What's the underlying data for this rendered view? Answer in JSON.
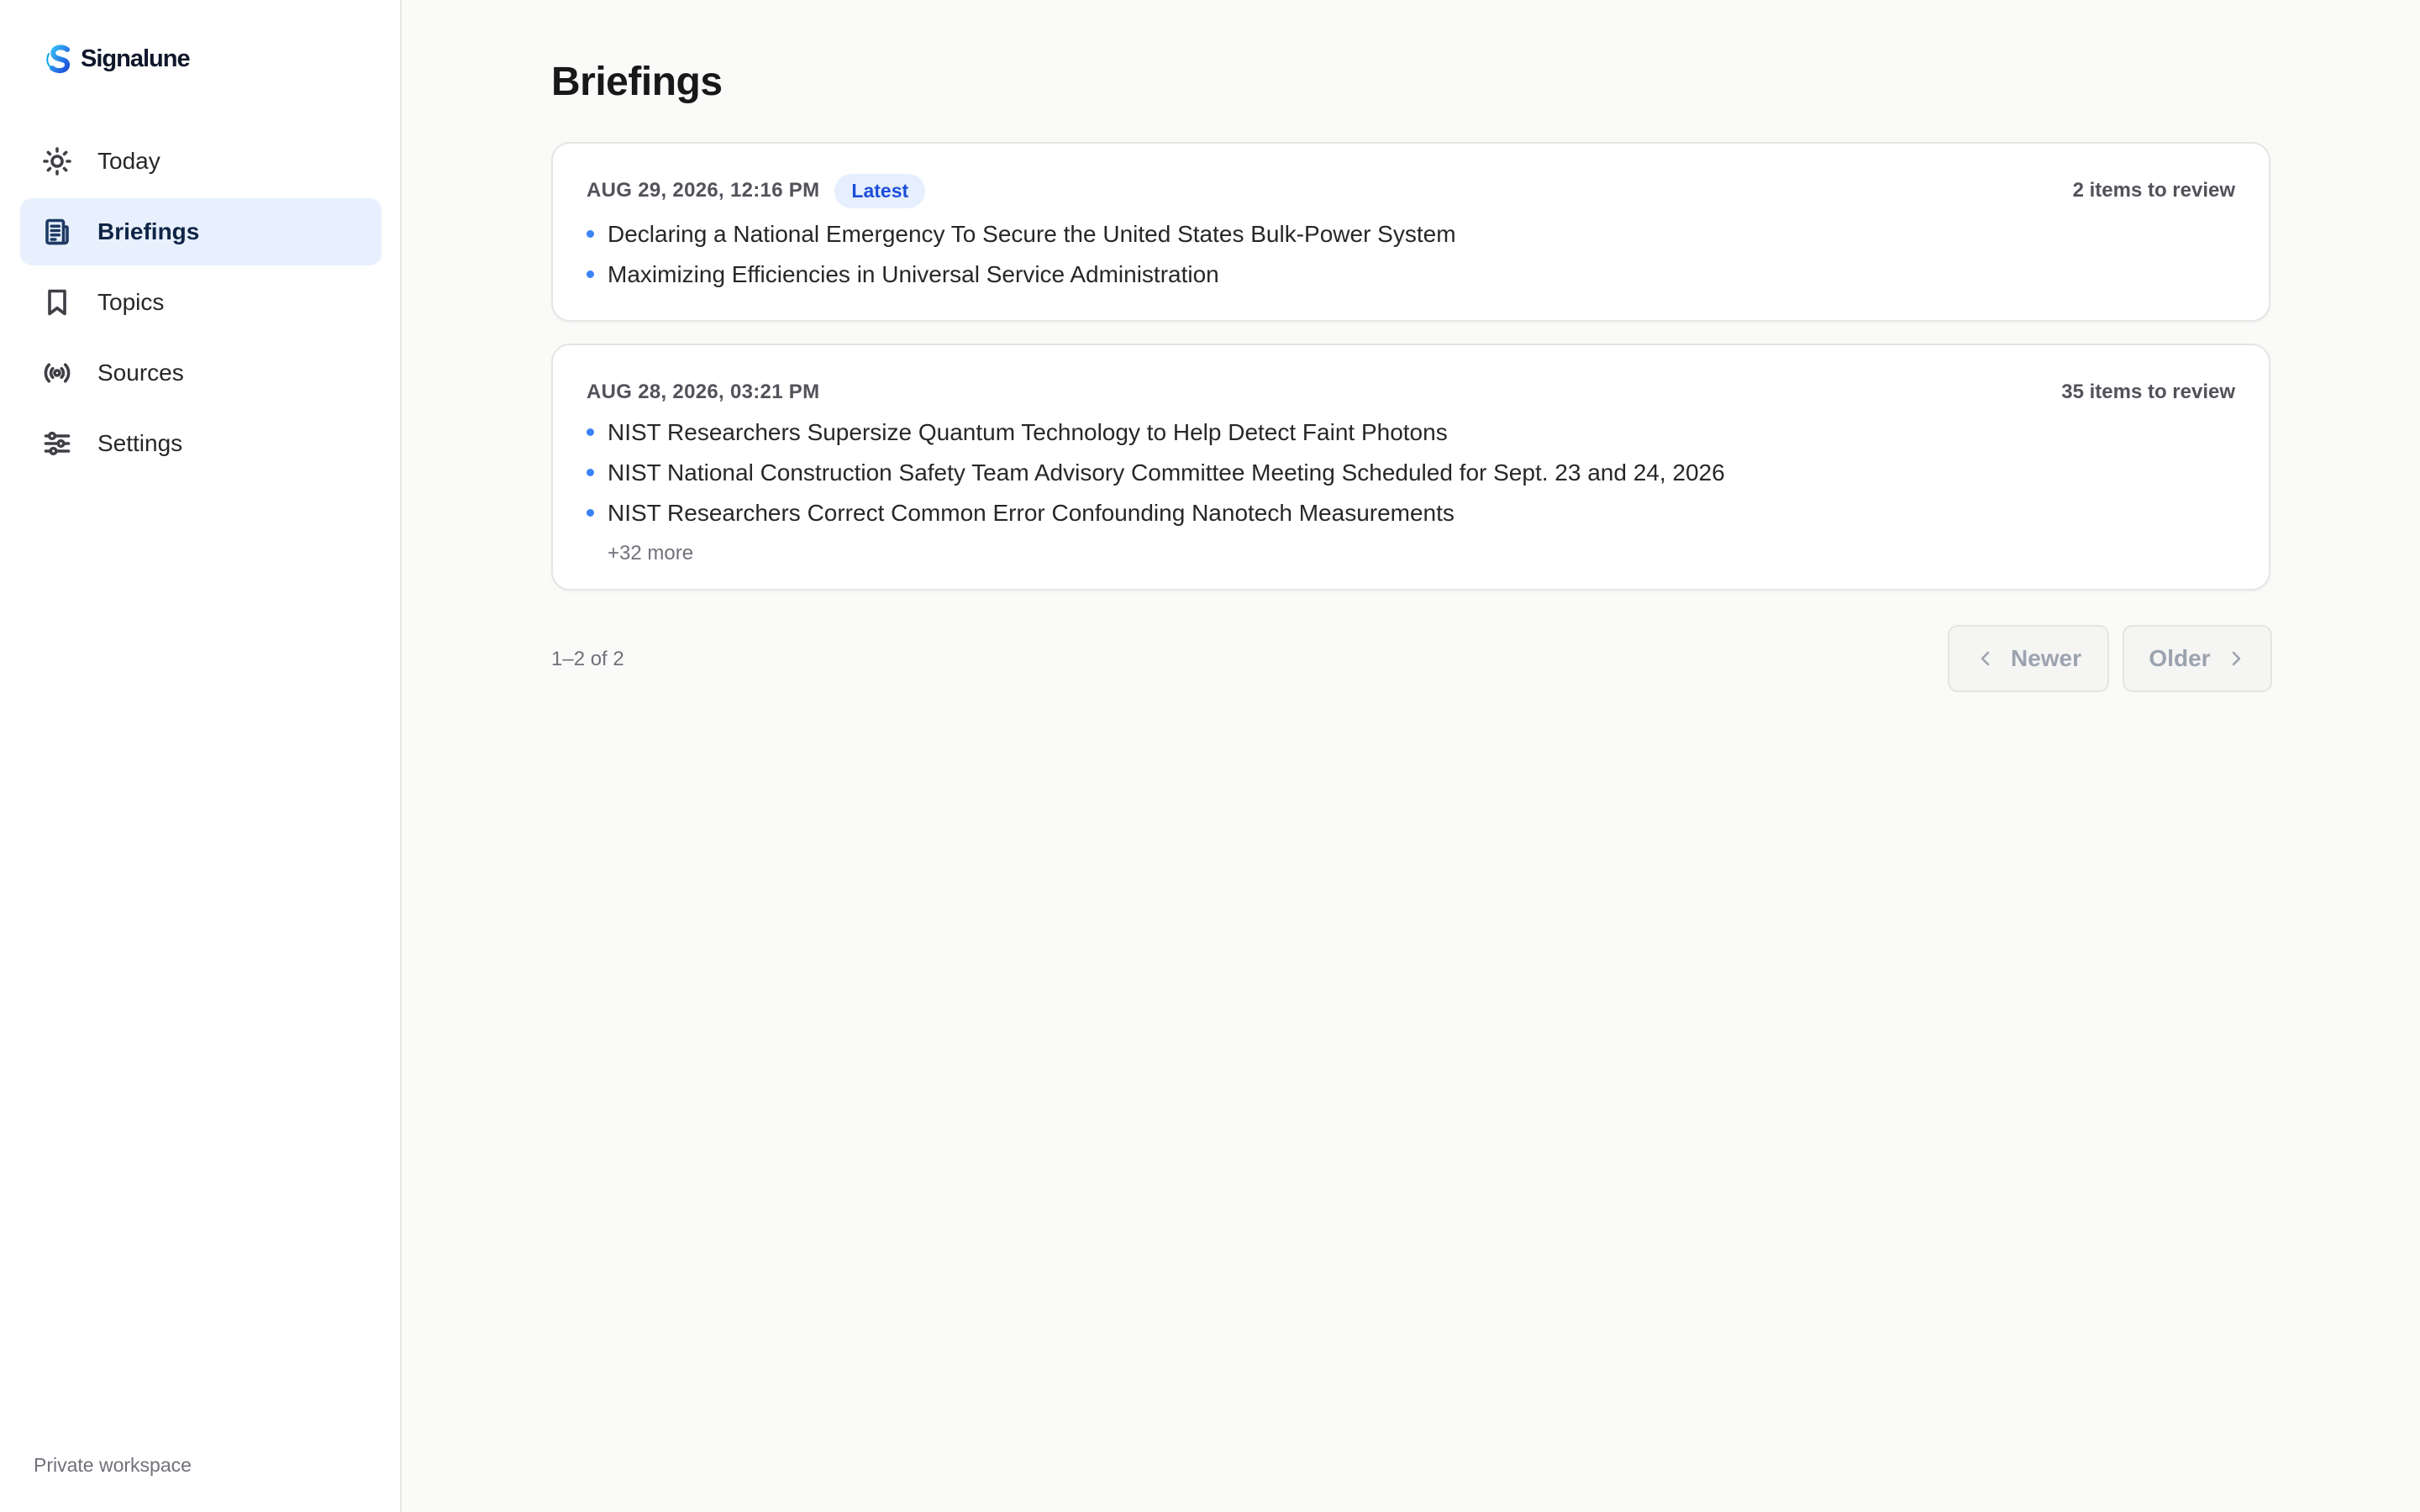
{
  "app": {
    "name": "Signalune"
  },
  "sidebar": {
    "items": [
      {
        "label": "Today",
        "icon": "sun-icon",
        "active": false
      },
      {
        "label": "Briefings",
        "icon": "newspaper-icon",
        "active": true
      },
      {
        "label": "Topics",
        "icon": "bookmark-icon",
        "active": false
      },
      {
        "label": "Sources",
        "icon": "broadcast-icon",
        "active": false
      },
      {
        "label": "Settings",
        "icon": "sliders-icon",
        "active": false
      }
    ],
    "footer": "Private workspace"
  },
  "page": {
    "title": "Briefings"
  },
  "briefings": [
    {
      "date": "AUG 29, 2026, 12:16 PM",
      "badge": "Latest",
      "count": "2 items to review",
      "items": [
        "Declaring a National Emergency To Secure the United States Bulk-Power System",
        "Maximizing Efficiencies in Universal Service Administration"
      ]
    },
    {
      "date": "AUG 28, 2026, 03:21 PM",
      "count": "35 items to review",
      "items": [
        "NIST Researchers Supersize Quantum Technology to Help Detect Faint Photons",
        "NIST National Construction Safety Team Advisory Committee Meeting Scheduled for Sept. 23 and 24, 2026",
        "NIST Researchers Correct Common Error Confounding Nanotech Measurements"
      ],
      "more": "+32 more"
    }
  ],
  "pagination": {
    "range": "1–2 of 2",
    "newer": "Newer",
    "older": "Older"
  },
  "colors": {
    "accent": "#3b82f6",
    "active_bg": "#e8f0fd",
    "badge_bg": "#e6effd",
    "badge_text": "#1d4ed8"
  }
}
